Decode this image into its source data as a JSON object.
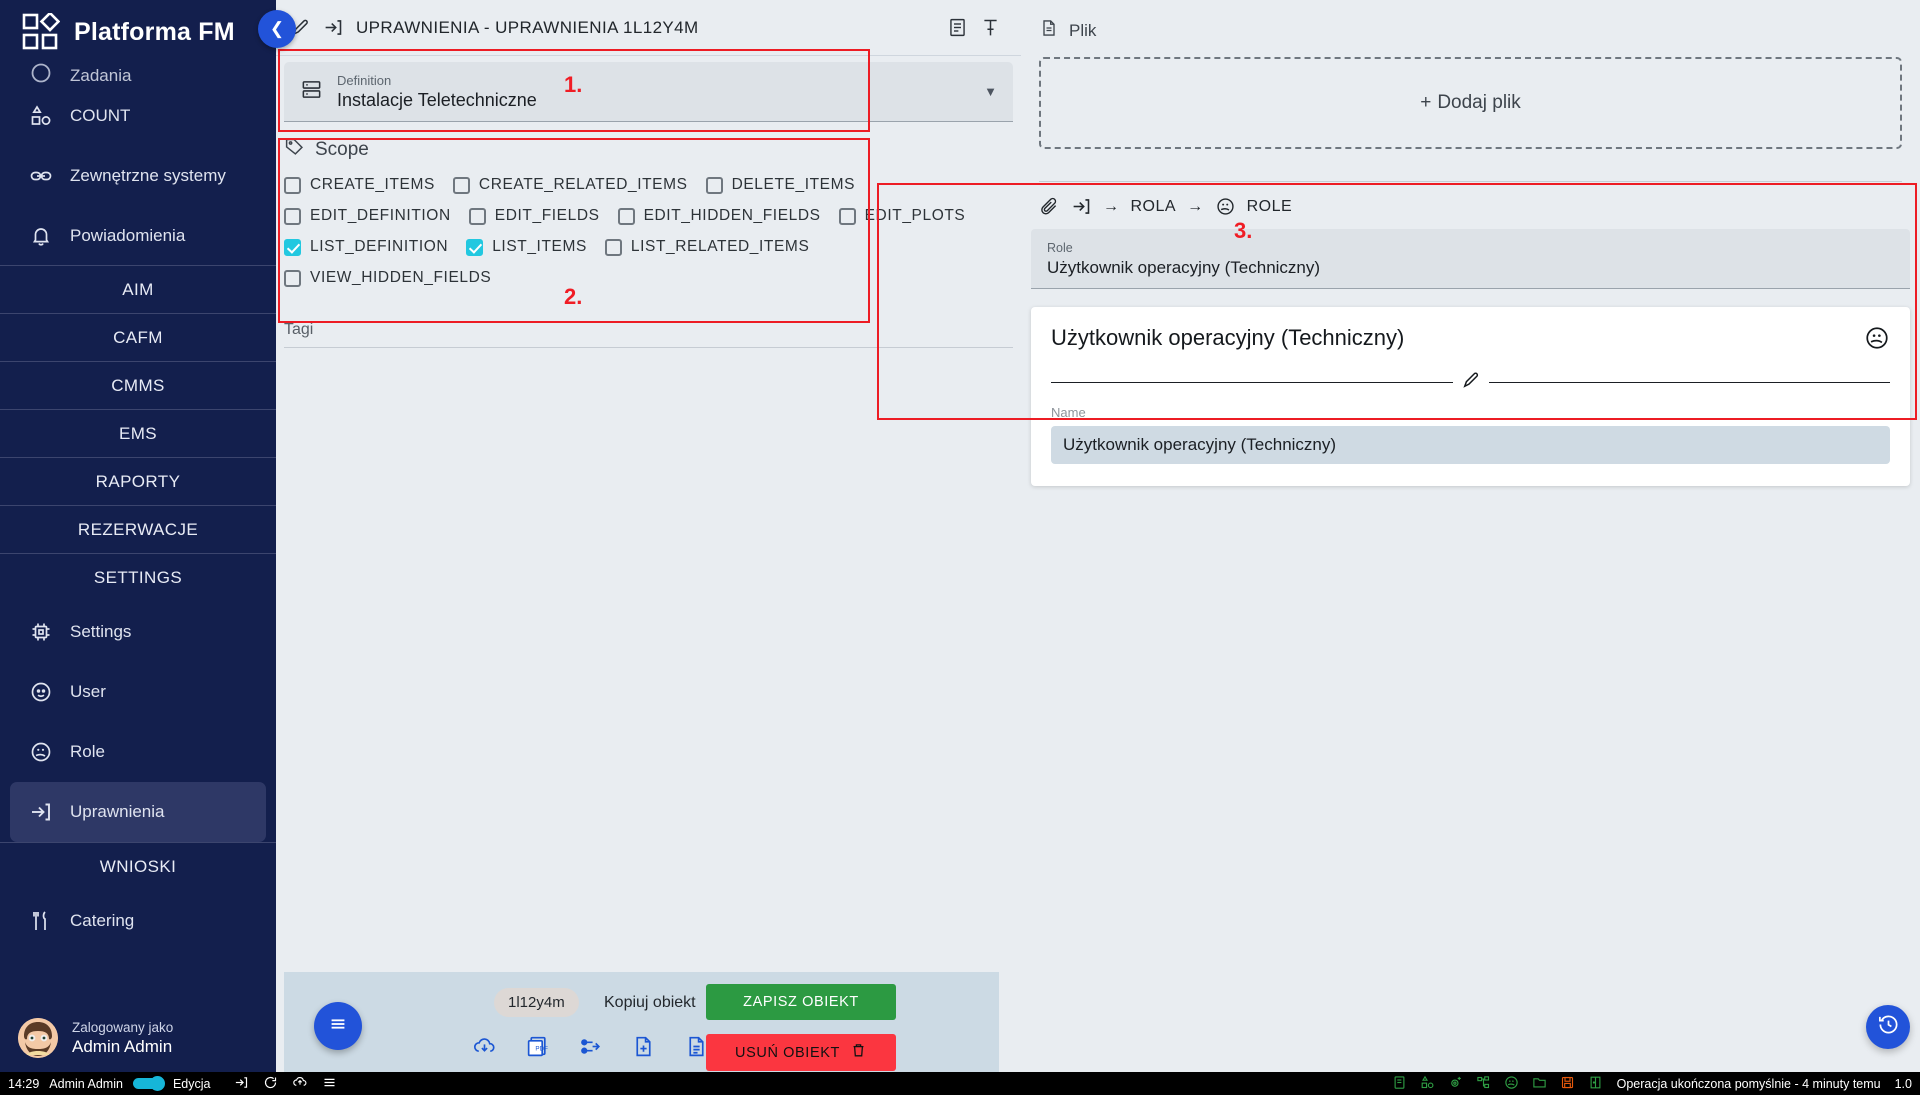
{
  "brand": {
    "title": "Platforma FM",
    "logo_icon": "grid-diamond-logo-icon"
  },
  "sidebar": {
    "collapse_button": "chevron-left-icon",
    "items_top": [
      {
        "label": "Zadania",
        "icon": "clock-icon",
        "clipped": true
      },
      {
        "label": "COUNT",
        "icon": "count-shapes-icon"
      },
      {
        "label": "Zewnętrzne systemy",
        "icon": "link-icon"
      },
      {
        "label": "Powiadomienia",
        "icon": "bell-icon"
      }
    ],
    "sections": [
      {
        "label": "AIM"
      },
      {
        "label": "CAFM"
      },
      {
        "label": "CMMS"
      },
      {
        "label": "EMS"
      },
      {
        "label": "RAPORTY"
      },
      {
        "label": "REZERWACJE"
      },
      {
        "label": "SETTINGS"
      }
    ],
    "settings_items": [
      {
        "label": "Settings",
        "icon": "cpu-gear-icon",
        "active": false
      },
      {
        "label": "User",
        "icon": "user-face-icon",
        "active": false
      },
      {
        "label": "Role",
        "icon": "role-mask-icon",
        "active": false
      },
      {
        "label": "Uprawnienia",
        "icon": "permissions-arrow-icon",
        "active": true
      }
    ],
    "wnioski_section": "WNIOSKI",
    "wnioski_items": [
      {
        "label": "Catering",
        "icon": "cutlery-icon"
      }
    ],
    "user": {
      "logged_as_label": "Zalogowany jako",
      "name": "Admin Admin",
      "avatar": "user-avatar"
    }
  },
  "page_head": {
    "edit_icon": "pencil-icon",
    "entity_icon": "permissions-arrow-icon",
    "title": "UPRAWNIENIA - UPRAWNIENIA 1L12Y4M",
    "note_icon": "note-icon",
    "pin_icon": "pin-icon"
  },
  "definition": {
    "icon": "server-rows-icon",
    "label": "Definition",
    "value": "Instalacje Teletechniczne",
    "caret": "chevron-down-icon"
  },
  "scope": {
    "icon": "tag-icon",
    "title": "Scope",
    "rows": [
      [
        {
          "label": "CREATE_ITEMS",
          "checked": false
        },
        {
          "label": "CREATE_RELATED_ITEMS",
          "checked": false
        },
        {
          "label": "DELETE_ITEMS",
          "checked": false
        }
      ],
      [
        {
          "label": "EDIT_DEFINITION",
          "checked": false
        },
        {
          "label": "EDIT_FIELDS",
          "checked": false
        },
        {
          "label": "EDIT_HIDDEN_FIELDS",
          "checked": false
        },
        {
          "label": "EDIT_PLOTS",
          "checked": false
        }
      ],
      [
        {
          "label": "LIST_DEFINITION",
          "checked": true
        },
        {
          "label": "LIST_ITEMS",
          "checked": true
        },
        {
          "label": "LIST_RELATED_ITEMS",
          "checked": false
        }
      ],
      [
        {
          "label": "VIEW_HIDDEN_FIELDS",
          "checked": false
        }
      ]
    ]
  },
  "tagi": {
    "label": "Tagi"
  },
  "annotations": [
    {
      "number": "1."
    },
    {
      "number": "2."
    },
    {
      "number": "3."
    }
  ],
  "file_panel": {
    "icon": "file-icon",
    "title": "Plik",
    "dropzone_label": "Dodaj plik",
    "dropzone_plus": "+"
  },
  "breadcrumb": {
    "attach_icon": "paperclip-icon",
    "permissions_icon": "permissions-arrow-icon",
    "arrow": "→",
    "items": [
      {
        "label": "ROLA",
        "icon": ""
      },
      {
        "label": "ROLE",
        "icon": "role-mask-icon"
      }
    ]
  },
  "role_panel": {
    "select_label": "Role",
    "select_value": "Użytkownik operacyjny (Techniczny)",
    "card_title": "Użytkownik operacyjny (Techniczny)",
    "card_icon": "role-mask-icon",
    "pencil_icon": "pencil-icon",
    "name_label": "Name",
    "name_value": "Użytkownik operacyjny (Techniczny)"
  },
  "actionbar": {
    "menu_icon": "hamburger-icon",
    "id_pill": "1l12y4m",
    "copy_label": "Kopiuj obiekt",
    "save_label": "ZAPISZ OBIEKT",
    "delete_label": "USUŃ OBIEKT",
    "delete_icon": "trash-icon",
    "icons": [
      "cloud-download-icon",
      "pdf-icon",
      "share-node-icon",
      "file-add-icon",
      "file-text-icon"
    ]
  },
  "fabs": {
    "expand_icon": "expand-arrows-icon",
    "history_icon": "history-clock-icon"
  },
  "taskbar": {
    "time": "14:29",
    "user": "Admin Admin",
    "mode_label": "Edycja",
    "left_icons": [
      "login-arrow-icon",
      "refresh-icon",
      "cloud-upload-icon",
      "hamburger-icon"
    ],
    "right_icons": [
      "note-icon",
      "count-shapes-icon",
      "gear-plus-icon",
      "tree-nodes-icon",
      "role-mask-icon",
      "folder-icon",
      "save-disk-icon",
      "door-exit-icon"
    ],
    "status": "Operacja ukończona pomyślnie - 4 minuty temu",
    "version": "1.0"
  },
  "colors": {
    "sidebar_bg": "#131f4d",
    "accent_blue": "#2253d9",
    "checkbox_on": "#22c8e0",
    "save_green": "#2c9a42",
    "delete_red": "#fb3640",
    "annotation_red": "#ed1c24",
    "page_bg": "#e9edf1"
  }
}
